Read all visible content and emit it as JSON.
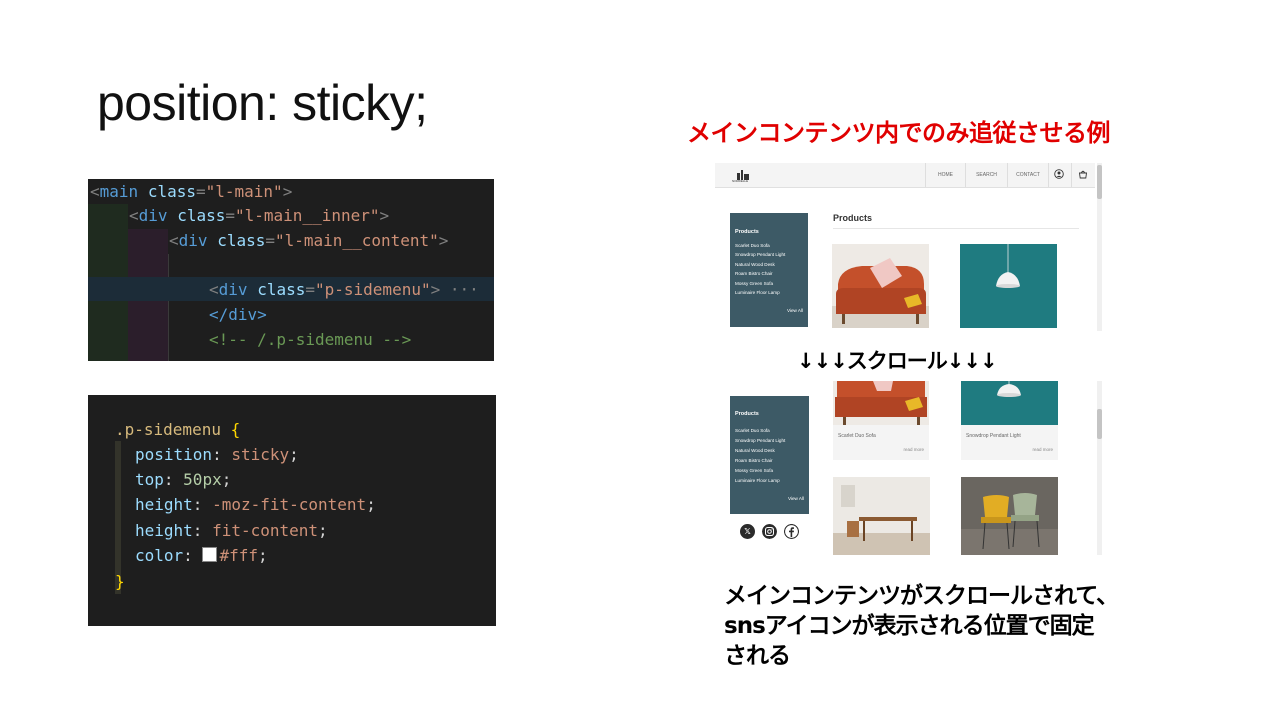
{
  "slide": {
    "title": "position: sticky;",
    "red_heading": "メインコンテンツ内でのみ追従させる例",
    "scroll_label": "↓↓↓スクロール↓↓↓",
    "caption_lines": [
      "メインコンテンツがスクロールされて、",
      "snsアイコンが表示される位置で固定",
      "される"
    ]
  },
  "html_code": {
    "l1": {
      "tag_open": "<",
      "tag": "main",
      "attr": "class",
      "eq": "=",
      "value": "\"l-main\"",
      "close": ">"
    },
    "l2": {
      "tag_open": "<",
      "tag": "div",
      "attr": "class",
      "eq": "=",
      "value": "\"l-main__inner\"",
      "close": ">"
    },
    "l3": {
      "tag_open": "<",
      "tag": "div",
      "attr": "class",
      "eq": "=",
      "value": "\"l-main__content\"",
      "close": ">"
    },
    "l5": {
      "tag_open": "<",
      "tag": "div",
      "attr": "class",
      "eq": "=",
      "value": "\"p-sidemenu\"",
      "close": ">",
      "fold": "···"
    },
    "l6": {
      "text": "</div>"
    },
    "l7": {
      "text": "<!-- /.p-sidemenu -->"
    }
  },
  "css_code": {
    "selector": ".p-sidemenu",
    "brace_open": "{",
    "brace_close": "}",
    "decls": [
      {
        "prop": "position",
        "colon": ": ",
        "value": "sticky",
        "semi": ";"
      },
      {
        "prop": "top",
        "colon": ": ",
        "value": "50px",
        "semi": ";"
      },
      {
        "prop": "height",
        "colon": ": ",
        "value": "-moz-fit-content",
        "semi": ";"
      },
      {
        "prop": "height",
        "colon": ": ",
        "value": "fit-content",
        "semi": ";"
      },
      {
        "prop": "color",
        "colon": ": ",
        "value": "#fff",
        "semi": ";"
      }
    ]
  },
  "mock_site": {
    "logo_text": "NORDELLE",
    "nav": [
      "HOME",
      "SEARCH",
      "CONTACT"
    ],
    "products_heading": "Products",
    "sidemenu": {
      "title": "Products",
      "items": [
        "Scarlet Duo Sofa",
        "Snowdrop Pendant Light",
        "Natural Wood Desk",
        "Roam Bistro Chair",
        "Mossy Green Sofa",
        "Luminaire Floor Lamp"
      ],
      "view_all": "View All"
    },
    "cards": [
      {
        "name": "Scarlet Duo Sofa",
        "more": "read more"
      },
      {
        "name": "Snowdrop Pendant Light",
        "more": "read more"
      }
    ],
    "sns": [
      "x-icon",
      "instagram-icon",
      "facebook-icon"
    ],
    "colors": {
      "sidemenu": "#3d5a66",
      "sofa": "#c4502b",
      "lamp_bg": "#1f7b80"
    }
  }
}
